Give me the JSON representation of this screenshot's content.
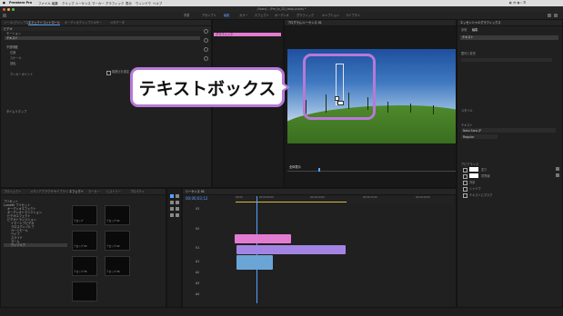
{
  "menubar": {
    "app_name": "Premiere Pro",
    "items": [
      "ファイル",
      "編集",
      "クリップ",
      "シーケンス",
      "マーカー",
      "グラフィック",
      "表示",
      "ウィンドウ",
      "ヘルプ"
    ]
  },
  "window_title": "/Users/…/Pre_tx_2D_telop.prproj *",
  "workspace_tabs": [
    "学習",
    "アセンブリ",
    "編集",
    "カラー",
    "エフェクト",
    "オーディオ",
    "グラフィック",
    "キャプション",
    "ライブラリ"
  ],
  "source_panel": {
    "tabs": [
      "ソース:(クリップなし)",
      "エフェクトコントロール",
      "オーディオクリップミキサー",
      "メタデータ"
    ],
    "clip_label": "グラフィック",
    "section_video": "ビデオ",
    "rows": [
      "モーション",
      "テキスト",
      "不透明度",
      "タイムリマップ"
    ],
    "sub_rows": [
      "位置",
      "スケール",
      "回転",
      "アンカーポイント"
    ],
    "checkbox_label": "縦横比を固定"
  },
  "program_panel": {
    "title": "プログラム:シーケンス 01",
    "timecode_left": "00;00;03;12",
    "fit_label": "全体表示"
  },
  "callout": {
    "text": "テキストボックス"
  },
  "essential_graphics": {
    "title": "エッセンシャルグラフィックス",
    "tabs": [
      "参照",
      "編集"
    ],
    "layer_label": "テキスト",
    "section_align": "整列と変形",
    "section_styles": "スタイル",
    "section_text": "テキスト",
    "font": "Noto Sans JP",
    "weight": "Regular",
    "section_appearance": "アピアランス",
    "appearance_rows": [
      "塗り",
      "境界線",
      "背景",
      "シャドウ",
      "テキストにマスク"
    ]
  },
  "project_panel": {
    "tabs": [
      "プロジェクト",
      "メディアブラウザー",
      "ライブラリ",
      "情報",
      "エフェクト",
      "マーカー",
      "ヒストリー",
      "プロパティ"
    ],
    "tree": [
      "プリセット",
      "Lumetri プリセット",
      "オーディオエフェクト",
      "オーディオトランジション",
      "ビデオエフェクト",
      "ビデオトランジション",
      "イマーシブビデオ",
      "クロスディゾルブ",
      "ページピール",
      "ワイプ",
      "スライド",
      "ズーム",
      "ディゾルブ"
    ],
    "thumb_labels": [
      "テロップ",
      "テロップ 02",
      "テロップ 03",
      "テロップ 04",
      "テロップ 05",
      "テロップ 06"
    ]
  },
  "timeline": {
    "title": "シーケンス 01",
    "timecode": "00;00;03;12",
    "tracks": [
      "V3",
      "V2",
      "V1",
      "A1",
      "A2",
      "A3",
      "A4"
    ],
    "ruler": [
      "00;00",
      "00;00;05;00",
      "00;00;10;00",
      "00;00;15;00",
      "00;00;20;00"
    ]
  },
  "colors": {
    "accent": "#b779d8",
    "timeline_pink": "#e37bd0",
    "timeline_purple": "#a384e3",
    "timeline_blue": "#6ba5d6"
  }
}
